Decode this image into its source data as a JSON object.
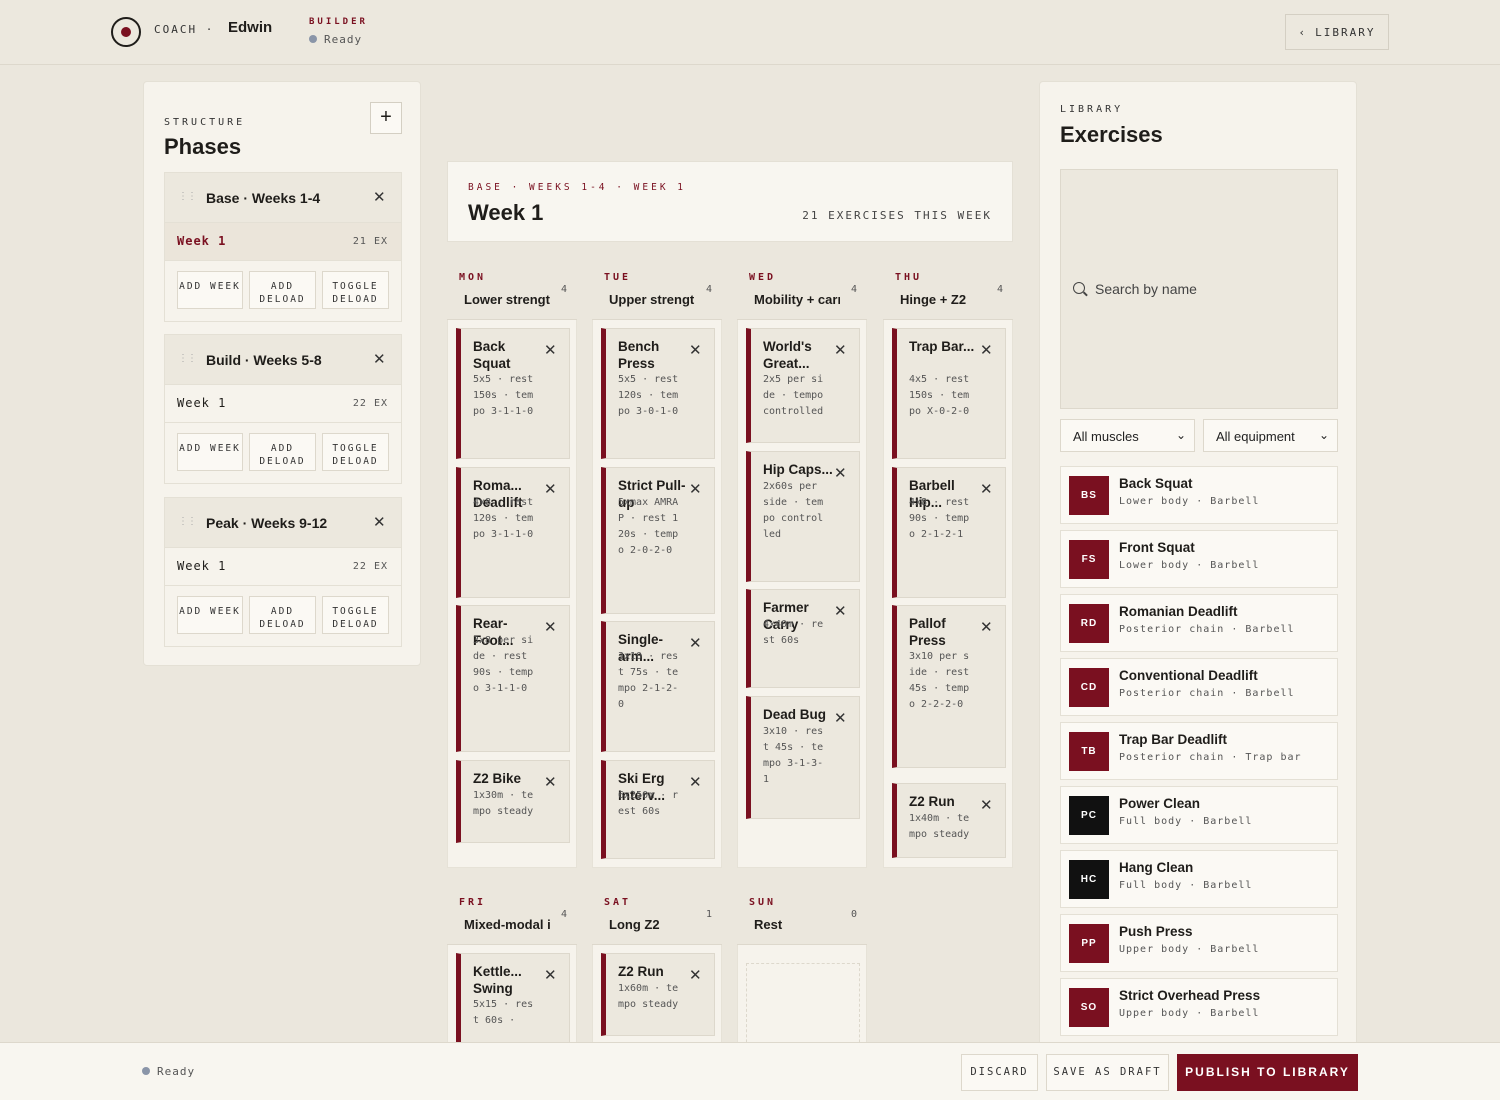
{
  "header": {
    "brand": "COACH",
    "separator": "·",
    "user": "Edwin",
    "builder_label": "BUILDER",
    "builder_status": "Ready",
    "library_button": "LIBRARY"
  },
  "structure": {
    "label": "STRUCTURE",
    "title": "Phases",
    "add_label": "+",
    "phases": [
      {
        "name": "Base · Weeks 1-4",
        "week": "Week 1",
        "ex": "21 EX",
        "btn_add_week": "ADD WEEK",
        "btn_add_deload": "ADD DELOAD",
        "btn_toggle": "TOGGLE DELOAD"
      },
      {
        "name": "Build · Weeks 5-8",
        "week": "Week 1",
        "ex": "22 EX",
        "btn_add_week": "ADD WEEK",
        "btn_add_deload": "ADD DELOAD",
        "btn_toggle": "TOGGLE DELOAD"
      },
      {
        "name": "Peak · Weeks 9-12",
        "week": "Week 1",
        "ex": "22 EX",
        "btn_add_week": "ADD WEEK",
        "btn_add_deload": "ADD DELOAD",
        "btn_toggle": "TOGGLE DELOAD"
      }
    ]
  },
  "week": {
    "breadcrumb": "BASE · WEEKS 1-4 · WEEK 1",
    "title": "Week 1",
    "count": "21 EXERCISES THIS WEEK"
  },
  "days": [
    {
      "label": "MON",
      "name": "Lower strength",
      "count": "4",
      "exercises": [
        {
          "name": "Back Squat",
          "detail": "5x5 · rest 150s · tempo 3-1-1-0"
        },
        {
          "name": "Roma... Deadlift",
          "detail": "4x8 · rest 120s · tempo 3-1-1-0"
        },
        {
          "name": "Rear-Foot...",
          "detail": "3x8 per side · rest 90s · tempo 3-1-1-0"
        },
        {
          "name": "Z2 Bike",
          "detail": "1x30m · tempo steady"
        }
      ]
    },
    {
      "label": "TUE",
      "name": "Upper strength",
      "count": "4",
      "exercises": [
        {
          "name": "Bench Press",
          "detail": "5x5 · rest 120s · tempo 3-0-1-0"
        },
        {
          "name": "Strict Pull-up",
          "detail": "5xmax AMRAP · rest 120s · tempo 2-0-2-0"
        },
        {
          "name": "Single-arm...",
          "detail": "3x10 · rest 75s · tempo 2-1-2-0"
        },
        {
          "name": "Ski Erg Interv...",
          "detail": "6x250m · rest 60s"
        }
      ]
    },
    {
      "label": "WED",
      "name": "Mobility + carries",
      "count": "4",
      "exercises": [
        {
          "name": "World's Great...",
          "detail": "2x5 per side · tempo controlled"
        },
        {
          "name": "Hip Caps...",
          "detail": "2x60s per side · tempo controlled"
        },
        {
          "name": "Farmer Carry",
          "detail": "4x40m · rest 60s"
        },
        {
          "name": "Dead Bug",
          "detail": "3x10 · rest 45s · tempo 3-1-3-1"
        }
      ]
    },
    {
      "label": "THU",
      "name": "Hinge + Z2",
      "count": "4",
      "exercises": [
        {
          "name": "Trap Bar...",
          "detail": "4x5 · rest 150s · tempo X-0-2-0"
        },
        {
          "name": "Barbell Hip...",
          "detail": "4x8 · rest 90s · tempo 2-1-2-1"
        },
        {
          "name": "Pallof Press",
          "detail": "3x10 per side · rest 45s · tempo 2-2-2-0"
        },
        {
          "name": "Z2 Run",
          "detail": "1x40m · tempo steady"
        }
      ]
    },
    {
      "label": "FRI",
      "name": "Mixed-modal intervals",
      "count": "4",
      "exercises": [
        {
          "name": "Kettle... Swing",
          "detail": "5x15 · rest 60s ·"
        }
      ]
    },
    {
      "label": "SAT",
      "name": "Long Z2",
      "count": "1",
      "exercises": [
        {
          "name": "Z2 Run",
          "detail": "1x60m · tempo steady"
        }
      ]
    },
    {
      "label": "SUN",
      "name": "Rest",
      "count": "0",
      "exercises": []
    }
  ],
  "library": {
    "label": "LIBRARY",
    "title": "Exercises",
    "search_placeholder": "Search by name",
    "filter_muscles": "All muscles",
    "filter_equipment": "All equipment",
    "items": [
      {
        "badge": "BS",
        "name": "Back Squat",
        "meta": "Lower body · Barbell",
        "dark": false
      },
      {
        "badge": "FS",
        "name": "Front Squat",
        "meta": "Lower body · Barbell",
        "dark": false
      },
      {
        "badge": "RD",
        "name": "Romanian Deadlift",
        "meta": "Posterior chain · Barbell",
        "dark": false
      },
      {
        "badge": "CD",
        "name": "Conventional Deadlift",
        "meta": "Posterior chain · Barbell",
        "dark": false
      },
      {
        "badge": "TB",
        "name": "Trap Bar Deadlift",
        "meta": "Posterior chain · Trap bar",
        "dark": false
      },
      {
        "badge": "PC",
        "name": "Power Clean",
        "meta": "Full body · Barbell",
        "dark": true
      },
      {
        "badge": "HC",
        "name": "Hang Clean",
        "meta": "Full body · Barbell",
        "dark": true
      },
      {
        "badge": "PP",
        "name": "Push Press",
        "meta": "Upper body · Barbell",
        "dark": false
      },
      {
        "badge": "SO",
        "name": "Strict Overhead Press",
        "meta": "Upper body · Barbell",
        "dark": false
      }
    ]
  },
  "footer": {
    "status": "Ready",
    "discard": "DISCARD",
    "save_draft": "SAVE AS DRAFT",
    "publish": "PUBLISH TO LIBRARY"
  },
  "colors": {
    "accent": "#7a1020",
    "background": "#ebe7dd"
  }
}
